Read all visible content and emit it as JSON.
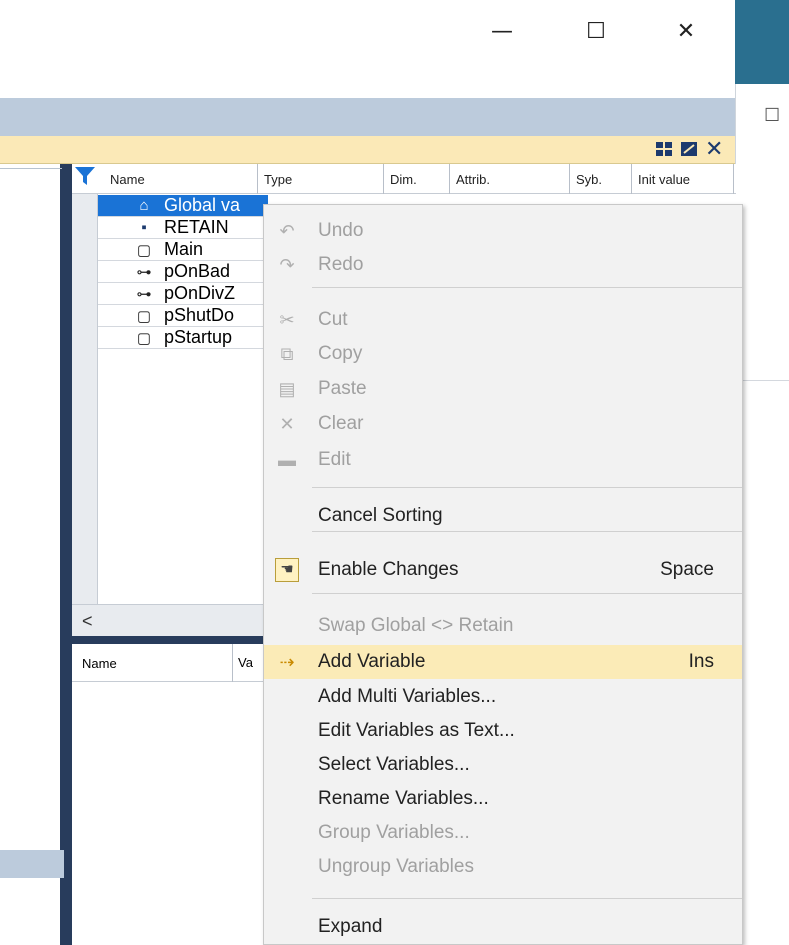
{
  "window": {
    "minimize": "—",
    "maximize": "☐",
    "close": "✕",
    "side_checkbox": "☐"
  },
  "panel": {
    "icons": [
      "tile-icon",
      "undock-icon",
      "close-icon"
    ]
  },
  "grid": {
    "columns": [
      "Name",
      "Type",
      "Dim.",
      "Attrib.",
      "Syb.",
      "Init value"
    ],
    "rows": [
      {
        "icon": "home-icon",
        "label": "Global va",
        "selected": true
      },
      {
        "icon": "disk-icon",
        "label": "RETAIN",
        "selected": false
      },
      {
        "icon": "page-icon",
        "label": "Main",
        "selected": false
      },
      {
        "icon": "tree-icon",
        "label": "pOnBad",
        "selected": false
      },
      {
        "icon": "tree-icon",
        "label": "pOnDivZ",
        "selected": false
      },
      {
        "icon": "page-icon",
        "label": "pShutDo",
        "selected": false
      },
      {
        "icon": "page-icon",
        "label": "pStartup",
        "selected": false
      }
    ],
    "scroll_left": "<"
  },
  "lower_grid": {
    "columns": [
      "Name",
      "Va"
    ]
  },
  "menu": {
    "items": [
      {
        "label": "Undo",
        "icon": "undo-icon",
        "disabled": true
      },
      {
        "label": "Redo",
        "icon": "redo-icon",
        "disabled": true
      },
      {
        "label": "Cut",
        "icon": "cut-icon",
        "disabled": true
      },
      {
        "label": "Copy",
        "icon": "copy-icon",
        "disabled": true
      },
      {
        "label": "Paste",
        "icon": "paste-icon",
        "disabled": true
      },
      {
        "label": "Clear",
        "icon": "clear-icon",
        "disabled": true
      },
      {
        "label": "Edit",
        "icon": "edit-icon",
        "disabled": true
      },
      {
        "label": "Cancel Sorting",
        "disabled": false
      },
      {
        "label": "Enable Changes",
        "icon": "hand-icon",
        "shortcut": "Space",
        "disabled": false
      },
      {
        "label": "Swap Global <> Retain",
        "disabled": true
      },
      {
        "label": "Add Variable",
        "icon": "add-variable-icon",
        "shortcut": "Ins",
        "disabled": false,
        "highlighted": true
      },
      {
        "label": "Add Multi Variables...",
        "disabled": false
      },
      {
        "label": "Edit Variables as Text...",
        "disabled": false
      },
      {
        "label": "Select Variables...",
        "disabled": false
      },
      {
        "label": "Rename Variables...",
        "disabled": false
      },
      {
        "label": "Group Variables...",
        "disabled": true
      },
      {
        "label": "Ungroup Variables",
        "disabled": true
      },
      {
        "label": "Expand",
        "disabled": false
      }
    ]
  },
  "colors": {
    "selection": "#1a73d6",
    "highlight": "#fbebb7",
    "panel_navy": "#283c5c",
    "title_teal": "#2a6f8f"
  }
}
